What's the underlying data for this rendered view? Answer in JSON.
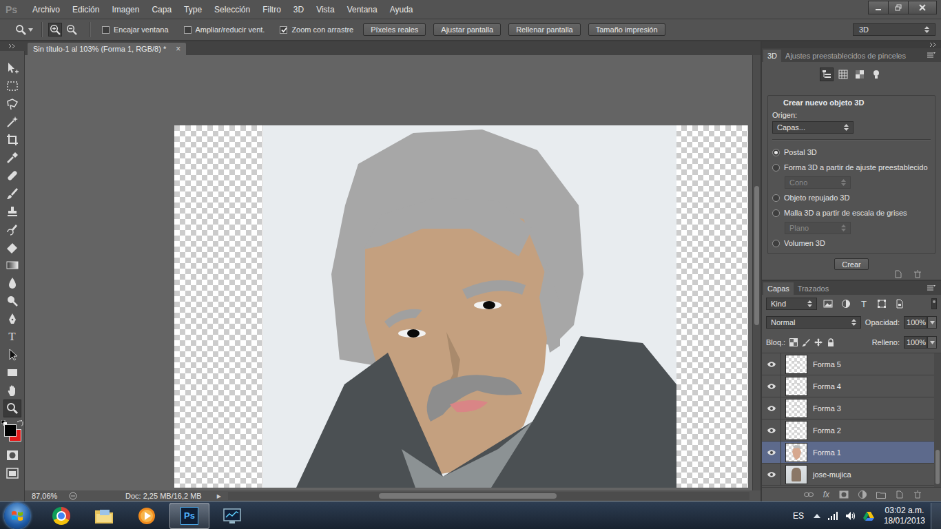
{
  "app": {
    "logo": "Ps"
  },
  "menu": [
    "Archivo",
    "Edición",
    "Imagen",
    "Capa",
    "Type",
    "Selección",
    "Filtro",
    "3D",
    "Vista",
    "Ventana",
    "Ayuda"
  ],
  "options_bar": {
    "zoom_buttons": [
      {
        "kind": "in",
        "selected": true
      },
      {
        "kind": "out",
        "selected": false
      }
    ],
    "checkboxes": [
      {
        "label": "Encajar ventana",
        "checked": false
      },
      {
        "label": "Ampliar/reducir vent.",
        "checked": false
      },
      {
        "label": "Zoom con arrastre",
        "checked": true
      }
    ],
    "buttons": [
      "Píxeles reales",
      "Ajustar pantalla",
      "Rellenar pantalla",
      "Tamaño impresión"
    ],
    "workspace": "3D"
  },
  "tools": [
    {
      "kind": "move",
      "selected": false
    },
    {
      "kind": "marquee",
      "selected": false
    },
    {
      "kind": "lasso",
      "selected": false
    },
    {
      "kind": "wand",
      "selected": false
    },
    {
      "kind": "crop",
      "selected": false
    },
    {
      "kind": "eyedropper",
      "selected": false
    },
    {
      "kind": "heal",
      "selected": false
    },
    {
      "kind": "brush",
      "selected": false
    },
    {
      "kind": "stamp",
      "selected": false
    },
    {
      "kind": "history",
      "selected": false
    },
    {
      "kind": "eraser",
      "selected": false
    },
    {
      "kind": "gradient",
      "selected": false
    },
    {
      "kind": "blur",
      "selected": false
    },
    {
      "kind": "dodge",
      "selected": false
    },
    {
      "kind": "pen",
      "selected": false
    },
    {
      "kind": "type",
      "label": "T",
      "selected": false
    },
    {
      "kind": "path-select",
      "selected": false
    },
    {
      "kind": "shape",
      "selected": false
    },
    {
      "kind": "hand",
      "selected": false
    },
    {
      "kind": "zoom",
      "selected": true
    }
  ],
  "colors": {
    "foreground": "#000000",
    "background": "#e41b1b"
  },
  "document": {
    "tab": "Sin título-1 al 103% (Forma 1, RGB/8) *",
    "close": "×",
    "zoom": "87,06%",
    "info": "Doc: 2,25 MB/16,2 MB",
    "info_arrow": "▶",
    "hscroll": {
      "start": 0.29,
      "level": 0.34
    },
    "vscroll": {
      "start": 0.3,
      "level": 0.32
    }
  },
  "panel_3d": {
    "tabs": [
      {
        "label": "3D",
        "selected": true
      },
      {
        "label": "Ajustes preestablecidos de pinceles",
        "selected": false
      }
    ],
    "view_icons": [
      {
        "kind": "scene",
        "selected": true
      },
      {
        "kind": "mesh",
        "selected": false
      },
      {
        "kind": "material",
        "selected": false
      },
      {
        "kind": "light",
        "selected": false
      }
    ],
    "title": "Crear nuevo objeto 3D",
    "source_label": "Origen:",
    "source": "Capas...",
    "options": [
      {
        "kind": "radio",
        "label": "Postal 3D",
        "selected": true,
        "disabled": false
      },
      {
        "kind": "radio",
        "label": "Forma 3D a partir de ajuste preestablecido",
        "selected": false,
        "disabled": false
      },
      {
        "kind": "select",
        "label": "Cono",
        "selected": false,
        "disabled": true
      },
      {
        "kind": "radio",
        "label": "Objeto repujado 3D",
        "selected": false,
        "disabled": false
      },
      {
        "kind": "radio",
        "label": "Malla 3D a partir de escala de grises",
        "selected": false,
        "disabled": false
      },
      {
        "kind": "select",
        "label": "Plano",
        "selected": false,
        "disabled": true
      },
      {
        "kind": "radio",
        "label": "Volumen 3D",
        "selected": false,
        "disabled": false
      }
    ],
    "create": "Crear"
  },
  "layers_panel": {
    "tabs": [
      {
        "label": "Capas",
        "selected": true
      },
      {
        "label": "Trazados",
        "selected": false
      }
    ],
    "filter": "Kind",
    "filter_icons": [
      {
        "kind": "pixel"
      },
      {
        "kind": "adjustment"
      },
      {
        "kind": "type",
        "label": "T"
      },
      {
        "kind": "shape"
      },
      {
        "kind": "smart"
      }
    ],
    "blend": "Normal",
    "opacity_label": "Opacidad:",
    "opacity": "100%",
    "lock_label": "Bloq.:",
    "fill_label": "Relleno:",
    "fill": "100%",
    "layers": [
      {
        "name": "Forma 5",
        "kind": "shape",
        "visible": true,
        "selected": false
      },
      {
        "name": "Forma 4",
        "kind": "shape",
        "visible": true,
        "selected": false
      },
      {
        "name": "Forma 3",
        "kind": "shape",
        "visible": true,
        "selected": false
      },
      {
        "name": "Forma 2",
        "kind": "shape",
        "visible": true,
        "selected": false
      },
      {
        "name": "Forma 1",
        "kind": "face",
        "visible": true,
        "selected": true
      },
      {
        "name": "jose-mujica",
        "kind": "photo",
        "visible": true,
        "selected": false
      }
    ],
    "fx": "fx",
    "scroll": {
      "start": 0.72,
      "level": 0.26
    }
  },
  "taskbar": {
    "apps": [
      {
        "kind": "chrome",
        "selected": false
      },
      {
        "kind": "explorer",
        "selected": false
      },
      {
        "kind": "media",
        "selected": false
      },
      {
        "kind": "photoshop",
        "label": "Ps",
        "selected": true
      },
      {
        "kind": "monitor",
        "selected": false
      }
    ],
    "language": "ES",
    "time": "03:02 a.m.",
    "date": "18/01/2013"
  }
}
